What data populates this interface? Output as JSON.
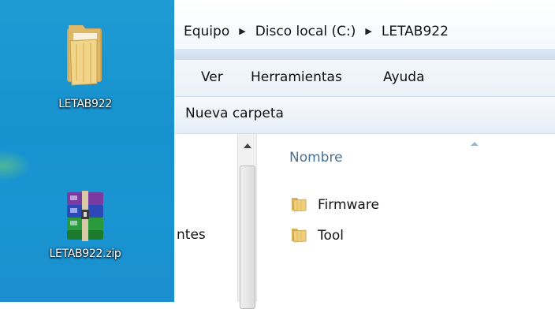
{
  "desktop": {
    "icons": [
      {
        "label": "LETAB922",
        "icon": "folder-icon"
      },
      {
        "label": "LETAB922.zip",
        "icon": "winrar-archive-icon"
      }
    ]
  },
  "explorer": {
    "breadcrumb": [
      "Equipo",
      "Disco local (C:)",
      "LETAB922"
    ],
    "menu": [
      "Ver",
      "Herramientas",
      "Ayuda"
    ],
    "toolbar": {
      "new_folder": "Nueva carpeta"
    },
    "nav_partial_text": "ntes",
    "column_header": "Nombre",
    "items": [
      {
        "name": "Firmware",
        "icon": "folder-icon"
      },
      {
        "name": "Tool",
        "icon": "folder-icon"
      }
    ]
  }
}
